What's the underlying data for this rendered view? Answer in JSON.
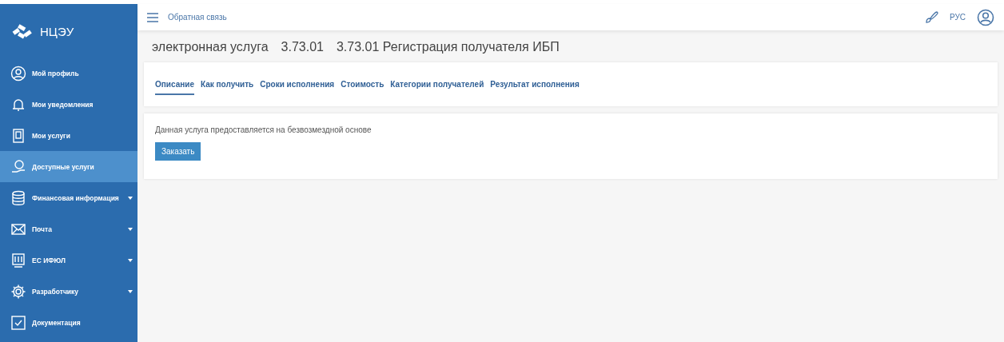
{
  "logo": {
    "text": "НЦЭУ"
  },
  "sidebar": {
    "items": [
      {
        "label": "Мой профиль",
        "selected": false,
        "has_submenu": false
      },
      {
        "label": "Мои уведомления",
        "selected": false,
        "has_submenu": false
      },
      {
        "label": "Мои услуги",
        "selected": false,
        "has_submenu": false
      },
      {
        "label": "Доступные услуги",
        "selected": true,
        "has_submenu": false
      },
      {
        "label": "Финансовая информация",
        "selected": false,
        "has_submenu": true
      },
      {
        "label": "Почта",
        "selected": false,
        "has_submenu": true
      },
      {
        "label": "ЕС ИФЮЛ",
        "selected": false,
        "has_submenu": true
      },
      {
        "label": "Разработчику",
        "selected": false,
        "has_submenu": true
      },
      {
        "label": "Документация",
        "selected": false,
        "has_submenu": false
      }
    ]
  },
  "header": {
    "feedback": "Обратная связь",
    "language": "РУС"
  },
  "title": {
    "parts": [
      "электронная услуга",
      "3.73.01",
      "3.73.01 Регистрация получателя ИБП"
    ]
  },
  "tabs": [
    {
      "label": "Описание",
      "selected": true
    },
    {
      "label": "Как получить",
      "selected": false
    },
    {
      "label": "Сроки исполнения",
      "selected": false
    },
    {
      "label": "Стоимость",
      "selected": false
    },
    {
      "label": "Категории получателей",
      "selected": false
    },
    {
      "label": "Результат исполнения",
      "selected": false
    }
  ],
  "content": {
    "text": "Данная услуга предоставляется на безвозмездной основе",
    "button": "Заказать"
  }
}
